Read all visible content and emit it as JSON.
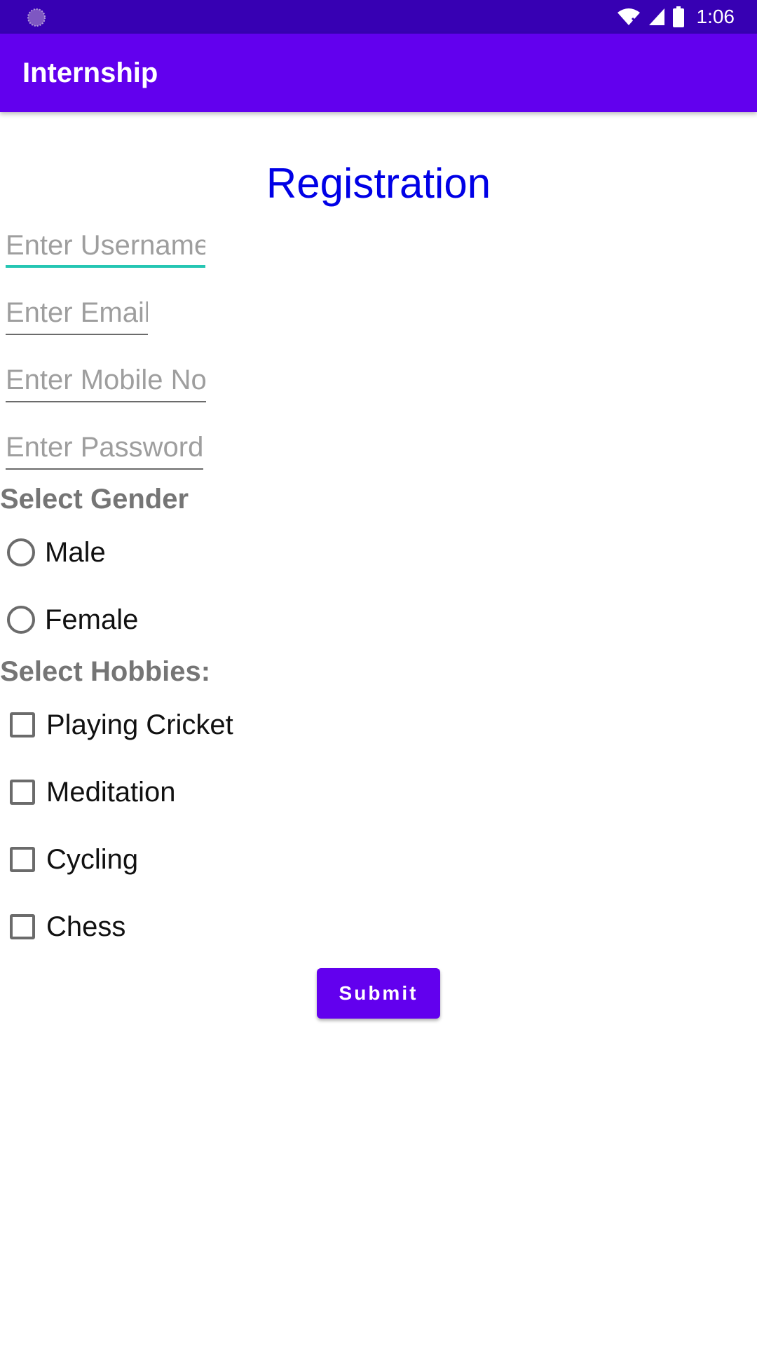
{
  "status_bar": {
    "time": "1:06",
    "icons": [
      "notification-icon",
      "wifi-icon",
      "signal-icon",
      "battery-icon"
    ]
  },
  "app_bar": {
    "title": "Internship"
  },
  "form": {
    "heading": "Registration",
    "username_placeholder": "Enter Username",
    "email_placeholder": "Enter Email",
    "mobile_placeholder": "Enter Mobile No",
    "password_placeholder": "Enter Password",
    "gender_label": "Select Gender",
    "gender_options": [
      "Male",
      "Female"
    ],
    "hobbies_label": "Select Hobbies:",
    "hobbies": [
      "Playing Cricket",
      "Meditation",
      "Cycling",
      "Chess"
    ],
    "submit_label": "Submit"
  },
  "colors": {
    "status_bar": "#3700B3",
    "app_bar": "#6200EE",
    "heading": "#0000E6",
    "focus_underline": "#26C6B3",
    "button": "#6200EE"
  }
}
